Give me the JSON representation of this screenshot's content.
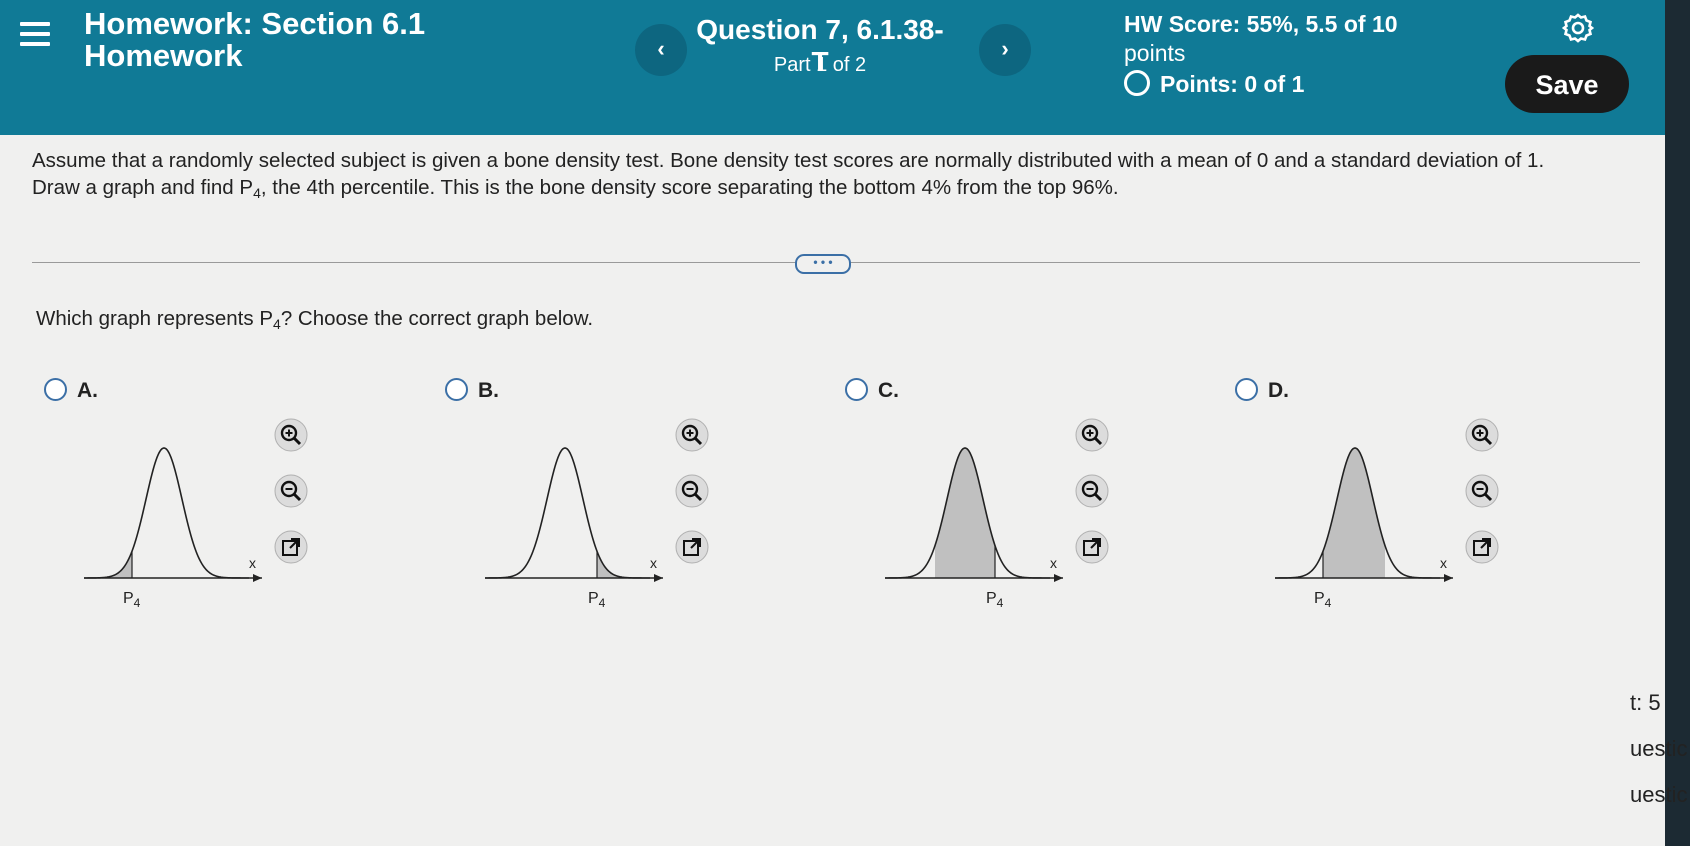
{
  "header": {
    "title_line1": "Homework: Section 6.1",
    "title_line2": "Homework",
    "prev_label": "‹",
    "next_label": "›",
    "question_title": "Question 7, 6.1.38-T",
    "question_part": "Part 1 of 2",
    "hw_score": "HW Score: 55%, 5.5 of 10",
    "hw_score_points": "points",
    "points": "Points: 0 of 1",
    "save_label": "Save",
    "icons": [
      "menu-icon",
      "chevron-left-icon",
      "chevron-right-icon",
      "gear-icon"
    ]
  },
  "question": {
    "text_line1": "Assume that a randomly selected subject is given a bone density test. Bone density test scores are normally distributed with a mean of 0 and a standard deviation of 1.",
    "text_line2_a": "Draw a graph and find P",
    "text_line2_sub": "4",
    "text_line2_b": ", the 4th percentile. This is the bone density score separating the bottom 4% from the top 96%.",
    "more_label": "• • •",
    "prompt_a": "Which graph represents P",
    "prompt_sub": "4",
    "prompt_b": "? Choose the correct graph below."
  },
  "options": [
    {
      "label": "A.",
      "graph_x": "x",
      "graph_p": "P",
      "graph_sub": "4",
      "shading": "left tail"
    },
    {
      "label": "B.",
      "graph_x": "x",
      "graph_p": "P",
      "graph_sub": "4",
      "shading": "right tail"
    },
    {
      "label": "C.",
      "graph_x": "x",
      "graph_p": "P",
      "graph_sub": "4",
      "shading": "left of center"
    },
    {
      "label": "D.",
      "graph_x": "x",
      "graph_p": "P",
      "graph_sub": "4",
      "shading": "right of left tail"
    }
  ],
  "side": {
    "line1": "t: 5",
    "line2": "uestic",
    "line3": "uestic"
  },
  "colors": {
    "header_bg": "#107a96",
    "save_bg": "#1a1a1a",
    "radio": "#3b6fa6",
    "shade": "#c0c0c0"
  }
}
